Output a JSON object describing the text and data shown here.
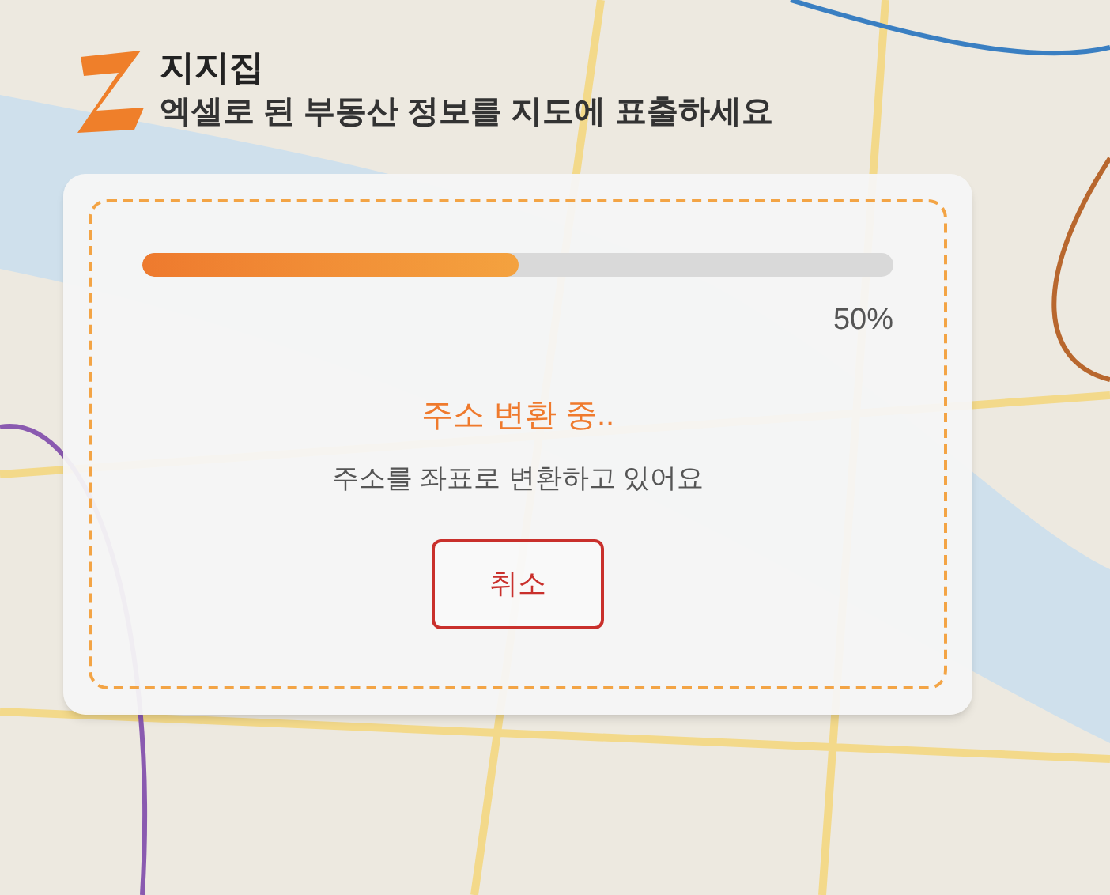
{
  "header": {
    "title": "지지집",
    "subtitle": "엑셀로 된 부동산 정보를 지도에 표출하세요"
  },
  "progress": {
    "level": 0.5,
    "reading": "50%"
  },
  "status": {
    "title": "주소 변환 중..",
    "message": "주소를 좌표로 변환하고 있어요"
  },
  "buttons": [
    {
      "kind": "cancel",
      "label": "취소"
    }
  ]
}
